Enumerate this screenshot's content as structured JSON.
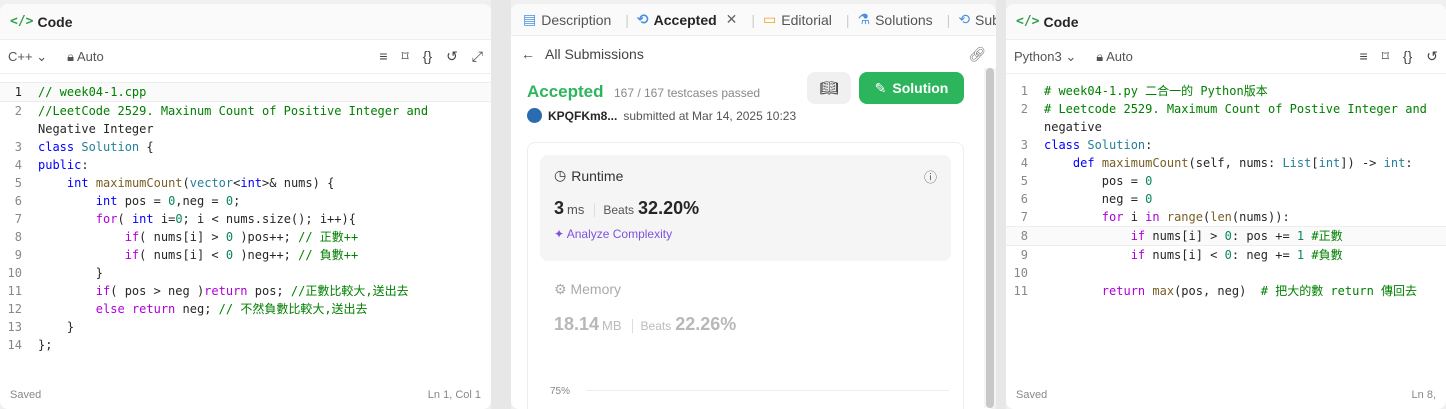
{
  "left": {
    "title": "Code",
    "lang": "C++",
    "mode": "Auto",
    "status_left": "Saved",
    "status_right": "Ln 1, Col 1",
    "lines": [
      {
        "n": "1",
        "t": "// week04-1.cpp"
      },
      {
        "n": "2",
        "t": "//LeetCode 2529. Maxinum Count of Positive Integer and"
      },
      {
        "n": "",
        "t": "Negative Integer"
      },
      {
        "n": "3",
        "t": "class Solution {"
      },
      {
        "n": "4",
        "t": "public:"
      },
      {
        "n": "5",
        "t": "    int maximumCount(vector<int>& nums) {"
      },
      {
        "n": "6",
        "t": "        int pos = 0,neg = 0;"
      },
      {
        "n": "7",
        "t": "        for( int i=0; i < nums.size(); i++){"
      },
      {
        "n": "8",
        "t": "            if( nums[i] > 0 )pos++; // 正數++"
      },
      {
        "n": "9",
        "t": "            if( nums[i] < 0 )neg++; // 負數++"
      },
      {
        "n": "10",
        "t": "        }"
      },
      {
        "n": "11",
        "t": "        if( pos > neg )return pos; //正數比較大,送出去"
      },
      {
        "n": "12",
        "t": "        else return neg; // 不然負數比較大,送出去"
      },
      {
        "n": "13",
        "t": "    }"
      },
      {
        "n": "14",
        "t": "};"
      }
    ]
  },
  "mid": {
    "tabs": [
      "Description",
      "Accepted",
      "Editorial",
      "Solutions",
      "Subm"
    ],
    "back_label": "All Submissions",
    "status": "Accepted",
    "testcases": "167 / 167 testcases passed",
    "user": "KPQFKm8...",
    "submitted": "submitted at Mar 14, 2025 10:23",
    "solution_btn": "Solution",
    "runtime_label": "Runtime",
    "runtime_value": "3",
    "runtime_unit": "ms",
    "beats_label": "Beats",
    "runtime_beats": "32.20%",
    "analyze": "Analyze Complexity",
    "memory_label": "Memory",
    "memory_value": "18.14",
    "memory_unit": "MB",
    "memory_beats": "22.26%",
    "axis_tick": "75%"
  },
  "right": {
    "title": "Code",
    "lang": "Python3",
    "mode": "Auto",
    "status_left": "Saved",
    "status_right": "Ln 8,",
    "lines": [
      {
        "n": "1",
        "t": "# week04-1.py 二合一的 Python版本"
      },
      {
        "n": "2",
        "t": "# Leetcode 2529. Maximum Count of Postive Integer and"
      },
      {
        "n": "",
        "t": "negative"
      },
      {
        "n": "3",
        "t": "class Solution:"
      },
      {
        "n": "4",
        "t": "    def maximumCount(self, nums: List[int]) -> int:"
      },
      {
        "n": "5",
        "t": "        pos = 0"
      },
      {
        "n": "6",
        "t": "        neg = 0"
      },
      {
        "n": "7",
        "t": "        for i in range(len(nums)):"
      },
      {
        "n": "8",
        "t": "            if nums[i] > 0: pos += 1 #正數"
      },
      {
        "n": "9",
        "t": "            if nums[i] < 0: neg += 1 #負數"
      },
      {
        "n": "10",
        "t": ""
      },
      {
        "n": "11",
        "t": "        return max(pos, neg)  # 把大的數 return 傳回去"
      }
    ]
  }
}
